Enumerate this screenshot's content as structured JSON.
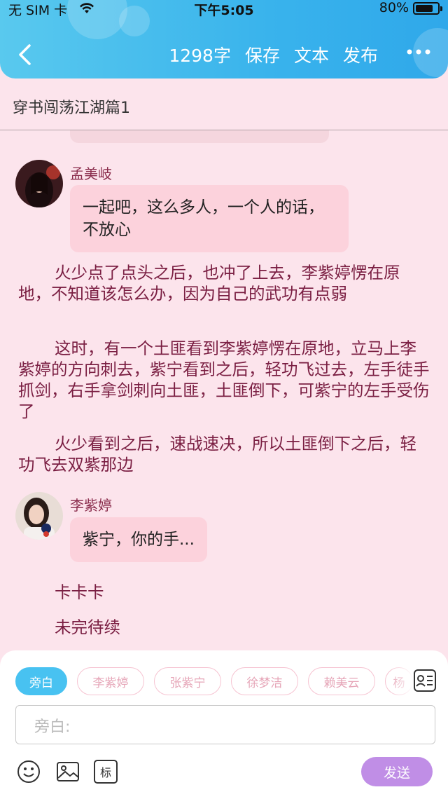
{
  "status_bar": {
    "carrier": "无 SIM 卡",
    "time": "下午5:05",
    "battery": "80%",
    "battery_level": 0.8
  },
  "nav": {
    "word_count": "1298字",
    "save": "保存",
    "text": "文本",
    "publish": "发布",
    "back_icon": "chevron-left-icon",
    "more_icon": "ellipsis-icon"
  },
  "document": {
    "title": "穿书闯荡江湖篇1"
  },
  "messages": [
    {
      "speaker": "孟美岐",
      "text": "一起吧，这么多人，一个人的话，不放心"
    },
    {
      "narration": "火少点了点头之后，也冲了上去，李紫婷愣在原地，不知道该怎么办，因为自己的武功有点弱"
    },
    {
      "narration": "这时，有一个土匪看到李紫婷愣在原地，立马上李紫婷的方向刺去，紫宁看到之后，轻功飞过去，左手徒手抓剑，右手拿剑刺向土匪，土匪倒下，可紫宁的左手受伤了"
    },
    {
      "narration": "火少看到之后，速战速决，所以土匪倒下之后，轻功飞去双紫那边"
    },
    {
      "speaker": "李紫婷",
      "text": "紫宁，你的手..."
    },
    {
      "narration": "卡卡卡"
    },
    {
      "narration": "未完待续"
    }
  ],
  "composer": {
    "roles": [
      "旁白",
      "李紫婷",
      "张紫宁",
      "徐梦洁",
      "赖美云",
      "杨"
    ],
    "active_role": "旁白",
    "placeholder": "旁白:",
    "send": "发送",
    "tag_button": "标",
    "icons": [
      "contact-card-icon",
      "emoji-icon",
      "image-icon",
      "tag-icon"
    ]
  },
  "colors": {
    "header_blue": "#39b3ec",
    "background_pink": "#fce4ec",
    "bubble_pink": "#fcd2dc",
    "narration_text": "#7a1e42",
    "send_purple": "#c08ee6"
  }
}
